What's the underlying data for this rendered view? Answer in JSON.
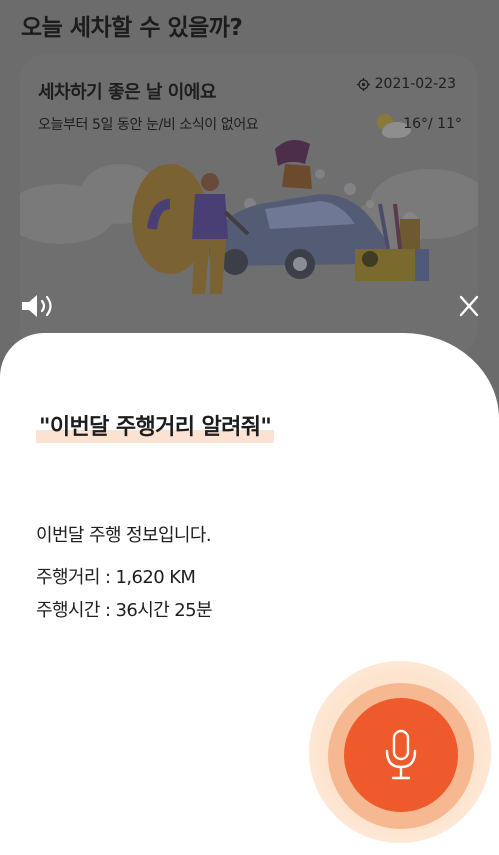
{
  "background": {
    "title": "오늘 세차할 수 있을까?",
    "card": {
      "headline": "세차하기 좋은 날 이에요",
      "subtitle": "오늘부터 5일 동안 눈/비 소식이 없어요",
      "date": "2021-02-23",
      "temperature": "16°/ 11°",
      "weather_icon": "sun-cloud-icon"
    }
  },
  "sheet": {
    "query": "\"이번달 주행거리 알려줘\"",
    "answer_intro": "이번달 주행 정보입니다.",
    "distance_line": "주행거리 : 1,620 KM",
    "time_line": "주행시간 : 36시간 25분"
  },
  "controls": {
    "sound_icon": "speaker-icon",
    "close_icon": "close-icon",
    "mic_icon": "microphone-icon"
  },
  "colors": {
    "overlay": "#6c6c6c",
    "sheet": "#ffffff",
    "highlight": "#fbe2d2",
    "mic_accent": "#ee5a2b",
    "mic_ring": "#f6b891"
  }
}
